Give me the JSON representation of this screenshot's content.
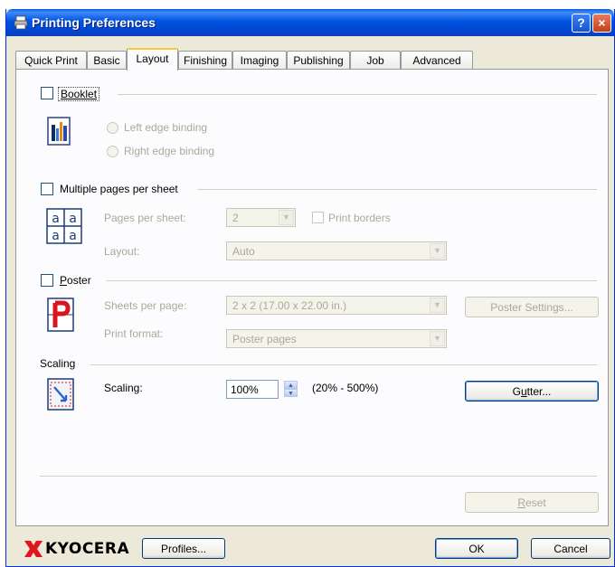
{
  "window": {
    "title": "Printing Preferences",
    "help_label": "?",
    "close_label": "×"
  },
  "tabs": [
    {
      "label": "Quick Print",
      "active": false
    },
    {
      "label": "Basic",
      "active": false
    },
    {
      "label": "Layout",
      "active": true
    },
    {
      "label": "Finishing",
      "active": false
    },
    {
      "label": "Imaging",
      "active": false
    },
    {
      "label": "Publishing",
      "active": false
    },
    {
      "label": "Job",
      "active": false
    },
    {
      "label": "Advanced",
      "active": false
    }
  ],
  "booklet": {
    "checkbox_label": "Booklet",
    "checked": false,
    "left_edge_binding": "Left edge binding",
    "right_edge_binding": "Right edge binding"
  },
  "multiple_pages": {
    "checkbox_label": "Multiple pages per sheet",
    "checked": false,
    "pages_per_sheet_label": "Pages per sheet:",
    "pages_per_sheet_value": "2",
    "print_borders_label": "Print borders",
    "layout_label": "Layout:",
    "layout_value": "Auto"
  },
  "poster": {
    "checkbox_label": "Poster",
    "checked": false,
    "sheets_per_page_label": "Sheets per page:",
    "sheets_per_page_value": "2 x 2 (17.00 x 22.00 in.)",
    "poster_settings_button": "Poster Settings...",
    "print_format_label": "Print format:",
    "print_format_value": "Poster pages"
  },
  "scaling": {
    "group_label": "Scaling",
    "label": "Scaling:",
    "value": "100%",
    "range": "(20% - 500%)",
    "gutter_button": "Gutter..."
  },
  "reset_button": "Reset",
  "footer": {
    "brand": "KYOCERA",
    "profiles_button": "Profiles...",
    "ok_button": "OK",
    "cancel_button": "Cancel"
  },
  "colors": {
    "title_bar": "#0053e0",
    "brand_red": "#e0161f",
    "active_tab_accent": "#ffc83c"
  }
}
